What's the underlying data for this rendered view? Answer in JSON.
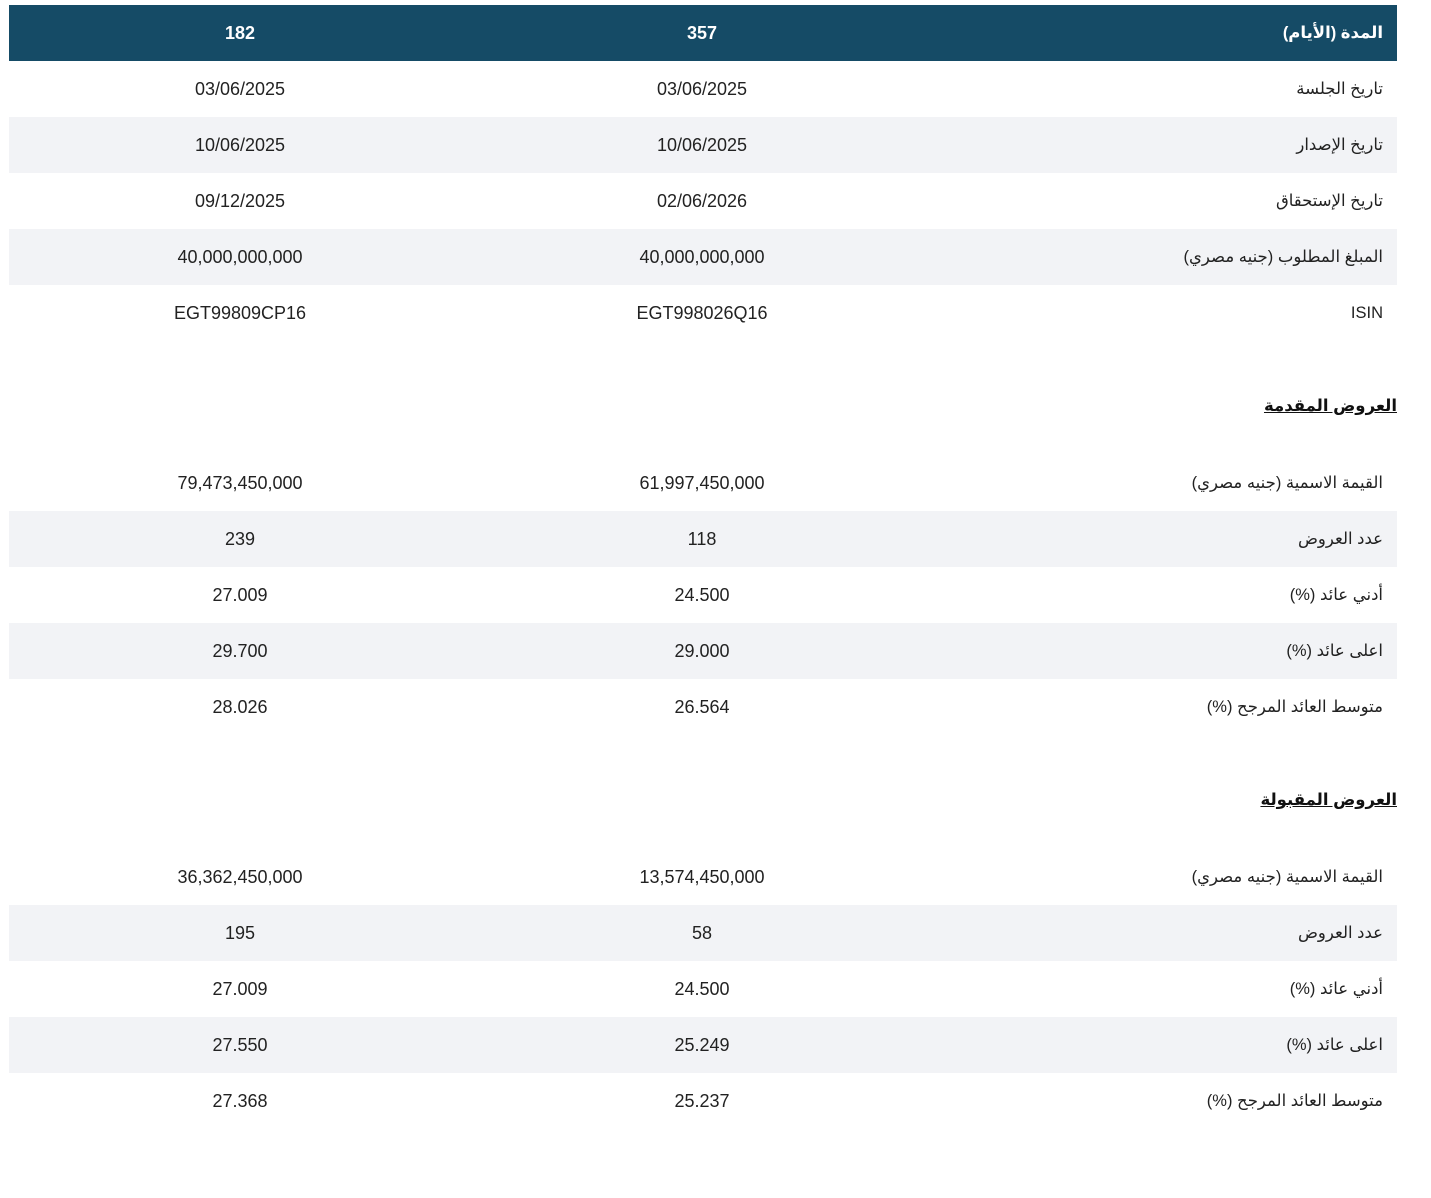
{
  "main_table": {
    "header": {
      "label": "المدة (الأيام)",
      "col1": "357",
      "col2": "182"
    },
    "rows": [
      {
        "label": "تاريخ الجلسة",
        "col1": "03/06/2025",
        "col2": "03/06/2025"
      },
      {
        "label": "تاريخ الإصدار",
        "col1": "10/06/2025",
        "col2": "10/06/2025"
      },
      {
        "label": "تاريخ الإستحقاق",
        "col1": "02/06/2026",
        "col2": "09/12/2025"
      },
      {
        "label": "المبلغ المطلوب (جنيه مصري)",
        "col1": "40,000,000,000",
        "col2": "40,000,000,000"
      },
      {
        "label": "ISIN",
        "col1": "EGT998026Q16",
        "col2": "EGT99809CP16"
      }
    ]
  },
  "submitted_bids": {
    "title": "العروض المقدمة",
    "rows": [
      {
        "label": "القيمة الاسمية (جنيه مصري)",
        "col1": "61,997,450,000",
        "col2": "79,473,450,000"
      },
      {
        "label": "عدد العروض",
        "col1": "118",
        "col2": "239"
      },
      {
        "label": "أدني عائد (%)",
        "col1": "24.500",
        "col2": "27.009"
      },
      {
        "label": "اعلى عائد (%)",
        "col1": "29.000",
        "col2": "29.700"
      },
      {
        "label": "متوسط العائد المرجح (%)",
        "col1": "26.564",
        "col2": "28.026"
      }
    ]
  },
  "accepted_bids": {
    "title": "العروض المقبولة",
    "rows": [
      {
        "label": "القيمة الاسمية (جنيه مصري)",
        "col1": "13,574,450,000",
        "col2": "36,362,450,000"
      },
      {
        "label": "عدد العروض",
        "col1": "58",
        "col2": "195"
      },
      {
        "label": "أدني عائد (%)",
        "col1": "24.500",
        "col2": "27.009"
      },
      {
        "label": "اعلى عائد (%)",
        "col1": "25.249",
        "col2": "27.550"
      },
      {
        "label": "متوسط العائد المرجح (%)",
        "col1": "25.237",
        "col2": "27.368"
      }
    ]
  },
  "colors": {
    "header_bg": "#154b66",
    "row_alt_bg": "#f2f3f6"
  }
}
